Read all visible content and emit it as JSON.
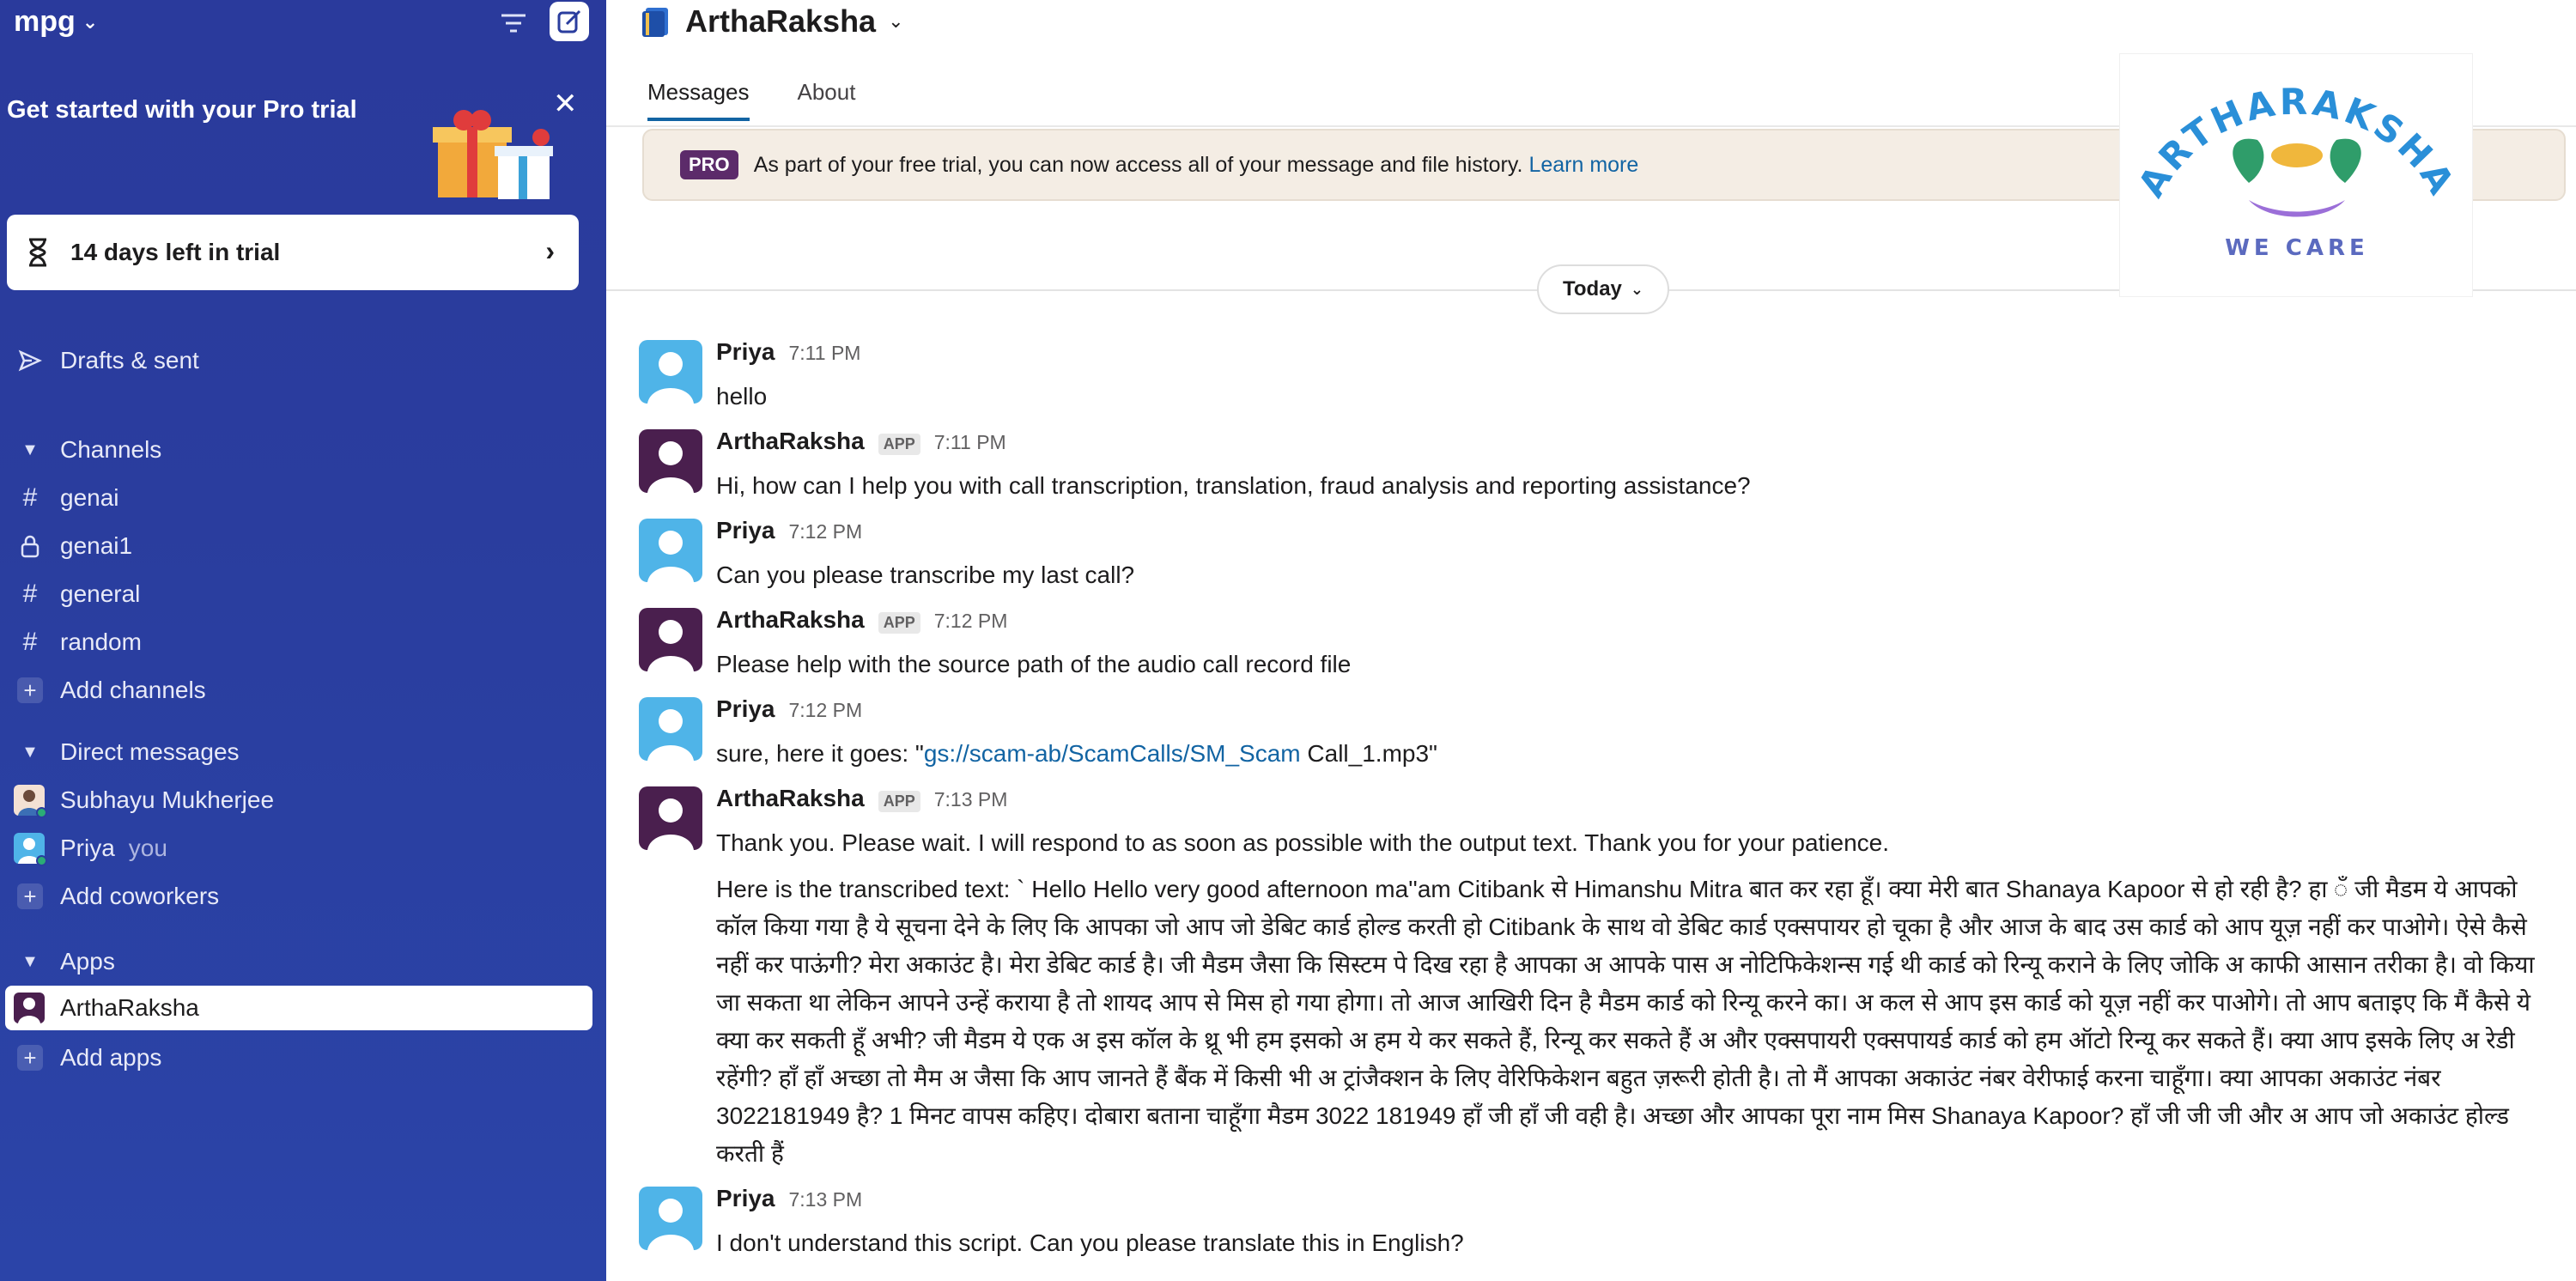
{
  "workspace": {
    "name": "mpg"
  },
  "trial": {
    "title": "Get started with your Pro trial",
    "days_left": "14 days left in trial"
  },
  "sidebar": {
    "drafts_label": "Drafts & sent",
    "channels_header": "Channels",
    "channels": [
      {
        "name": "genai",
        "icon": "hash-icon"
      },
      {
        "name": "genai1",
        "icon": "lock-icon"
      },
      {
        "name": "general",
        "icon": "hash-icon"
      },
      {
        "name": "random",
        "icon": "hash-icon"
      }
    ],
    "add_channels": "Add channels",
    "dm_header": "Direct messages",
    "dms": [
      {
        "name": "Subhayu Mukherjee"
      },
      {
        "name": "Priya",
        "tag": "you"
      }
    ],
    "add_coworkers": "Add coworkers",
    "apps_header": "Apps",
    "apps": [
      {
        "name": "ArthaRaksha"
      }
    ],
    "add_apps": "Add apps"
  },
  "channel": {
    "title": "ArthaRaksha",
    "tabs": [
      "Messages",
      "About"
    ]
  },
  "pro_banner": {
    "badge": "PRO",
    "text": "As part of your free trial, you can now access all of your message and file history.",
    "link": "Learn more"
  },
  "logo": {
    "top_text": "ARTHARAKSHA",
    "tagline": "WE CARE"
  },
  "day_divider": "Today",
  "messages": [
    {
      "sender": "Priya",
      "time": "7:11 PM",
      "text": "hello"
    },
    {
      "sender": "ArthaRaksha",
      "app_tag": "APP",
      "time": "7:11 PM",
      "text": "Hi, how can I help you with call transcription, translation, fraud analysis and reporting assistance?"
    },
    {
      "sender": "Priya",
      "time": "7:12 PM",
      "text": "Can you please transcribe my last call?"
    },
    {
      "sender": "ArthaRaksha",
      "app_tag": "APP",
      "time": "7:12 PM",
      "text": "Please help with the source path of the audio call record file"
    },
    {
      "sender": "Priya",
      "time": "7:12 PM",
      "text_prefix": "sure, here it goes: \"",
      "link": "gs://scam-ab/ScamCalls/SM_Scam",
      "text_suffix": " Call_1.mp3\""
    },
    {
      "sender": "ArthaRaksha",
      "app_tag": "APP",
      "time": "7:13 PM",
      "text": "Thank you. Please wait. I will respond to as soon as possible with the output text. Thank you for your patience.",
      "transcript": "Here is the transcribed text: ` Hello   Hello very good afternoon ma''am Citibank से Himanshu Mitra बात कर रहा   हूँ। क्या मेरी बात Shanaya Kapoor से हो रही है? हा  ँ जी मैडम ये आपको कॉल किया गया है ये सूचना देने के लिए कि आपका जो आप जो डेबिट कार्ड होल्ड करती   हो Citibank के साथ वो डेबिट कार्ड एक्सपायर हो चूका है और आज के बाद उस कार्ड को आप यूज़ नहीं   कर पाओगे। ऐसे कैसे नहीं कर पाऊंगी? मेरा अकाउंट है। मेरा डेबिट कार्ड है। जी मैडम जैसा कि सिस्टम पे दिख रहा है आपका अ आपके पास   अ नोटिफिकेशन्स गई थी कार्ड को रिन्यू कराने के लिए जोकि अ काफी आसान तरीका है। वो किया जा सकता था लेकिन आपने उन्हें कराया है तो शायद आप  से मिस हो गया होगा। तो आज आखिरी दिन है मैडम कार्ड को रिन्यू करने का। अ कल से आप इस कार्ड को यूज़ नहीं कर पाओगे। तो आप बताइए कि मैं कैसे ये क्या कर सकती हूँ अभी? जी मैडम   ये एक अ इस कॉल के थ्रू भी हम इसको अ हम ये कर सकते हैं, रिन्यू कर सकते हैं अ और एक्सपायरी एक्सपायर्ड कार्ड को हम ऑटो रिन्यू कर सकते हैं। क्या आप इसके लिए अ रेडी रहेंगी?   हाँ हाँ अच्छा तो मैम अ जैसा कि आप जानते हैं बैंक में किसी भी अ ट्रांजैक्शन के लिए वेरिफिकेशन बहुत ज़रूरी होती है। तो मैं आपका अकाउंट नंबर वेरीफाई करना चाहूँगा। क्या   आपका अकाउंट नंबर 3022181949 है? 1 मिनट वापस कहिए। दोबारा बताना चाहूँगा मैडम 3022 181949 हाँ जी हाँ जी वही है। अच्छा   और आपका पूरा नाम मिस Shanaya Kapoor? हाँ जी जी जी और अ आप जो अकाउंट होल्ड करती हैं"
    },
    {
      "sender": "Priya",
      "time": "7:13 PM",
      "text": "I don't understand this script. Can you please translate this in English?"
    }
  ],
  "colors": {
    "sidebar_bg": "#2a3d9e",
    "link": "#1264a3",
    "pro_badge": "#5c2b6a",
    "banner_bg": "#f4ede4",
    "presence": "#2bac76"
  }
}
